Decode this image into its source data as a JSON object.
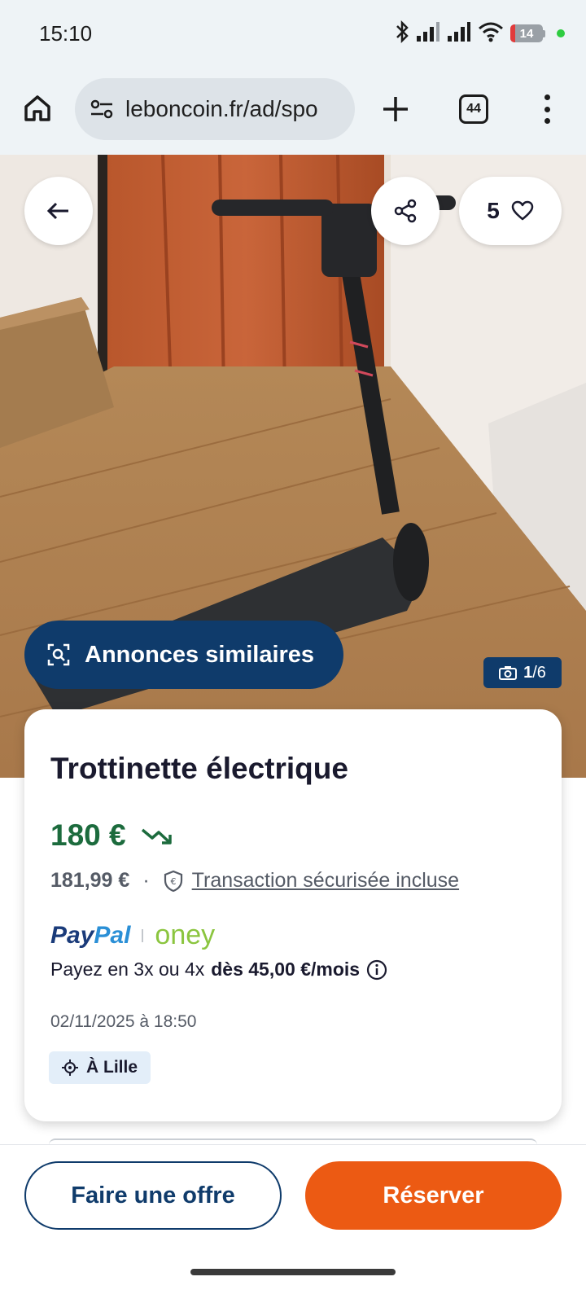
{
  "status_bar": {
    "time": "15:10",
    "battery_level": "14",
    "battery_fraction": 0.14,
    "icons": [
      "bluetooth-icon",
      "signal-icon",
      "signal-icon",
      "wifi-icon",
      "battery-icon"
    ]
  },
  "browser": {
    "url": "leboncoin.fr/ad/spo",
    "tab_count": "44"
  },
  "hero": {
    "favorites_count": "5",
    "similar_label": "Annonces similaires",
    "photo_current": "1",
    "photo_total": "/6"
  },
  "ad": {
    "title": "Trottinette électrique",
    "price": "180 €",
    "price_total": "181,99 €",
    "separator": "·",
    "secure_label": "Transaction sécurisée incluse",
    "paypal_a": "Pay",
    "paypal_b": "Pal",
    "oney": "oney",
    "installments_prefix": "Payez en 3x ou 4x",
    "installments_amount": "dès 45,00 €/mois",
    "date": "02/11/2025 à 18:50",
    "location": "À Lille"
  },
  "actions": {
    "offer_label": "Faire une offre",
    "reserve_label": "Réserver"
  },
  "colors": {
    "brand_blue": "#0f3b6b",
    "reserve_orange": "#ec5a13",
    "price_green": "#1c6b3d"
  }
}
